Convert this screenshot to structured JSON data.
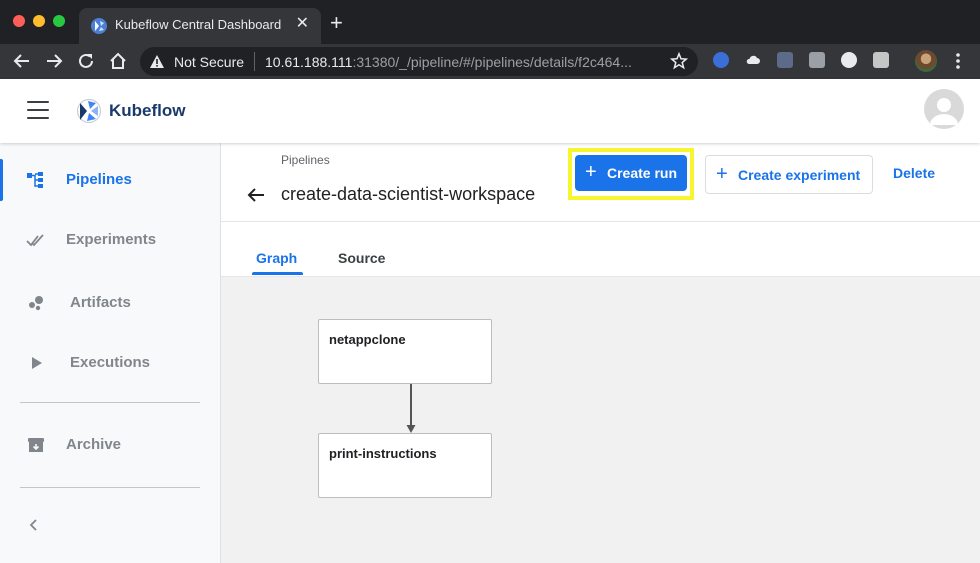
{
  "browser": {
    "tab_title": "Kubeflow Central Dashboard",
    "tab_close": "✕",
    "new_tab": "+",
    "security_label": "Not Secure",
    "url_host": "10.61.188.111",
    "url_rest": ":31380/_/pipeline/#/pipelines/details/f2c464..."
  },
  "app": {
    "name": "Kubeflow"
  },
  "sidebar": {
    "items": [
      {
        "label": "Pipelines",
        "icon": "pipelines-icon",
        "active": true
      },
      {
        "label": "Experiments",
        "icon": "experiments-icon",
        "active": false
      },
      {
        "label": "Artifacts",
        "icon": "artifacts-icon",
        "active": false
      },
      {
        "label": "Executions",
        "icon": "executions-icon",
        "active": false
      },
      {
        "label": "Archive",
        "icon": "archive-icon",
        "active": false
      }
    ],
    "collapse_icon": "chevron-left-icon"
  },
  "page": {
    "breadcrumb": "Pipelines",
    "title": "create-data-scientist-workspace",
    "actions": {
      "create_run": "Create run",
      "create_experiment": "Create experiment",
      "delete": "Delete",
      "plus_glyph": "+"
    },
    "tabs": [
      {
        "label": "Graph",
        "active": true
      },
      {
        "label": "Source",
        "active": false
      }
    ]
  },
  "graph": {
    "nodes": [
      {
        "label": "netappclone"
      },
      {
        "label": "print-instructions"
      }
    ]
  },
  "colors": {
    "accent": "#1a73e8",
    "highlight": "#f7f430",
    "brand": "#1a3a6b"
  }
}
